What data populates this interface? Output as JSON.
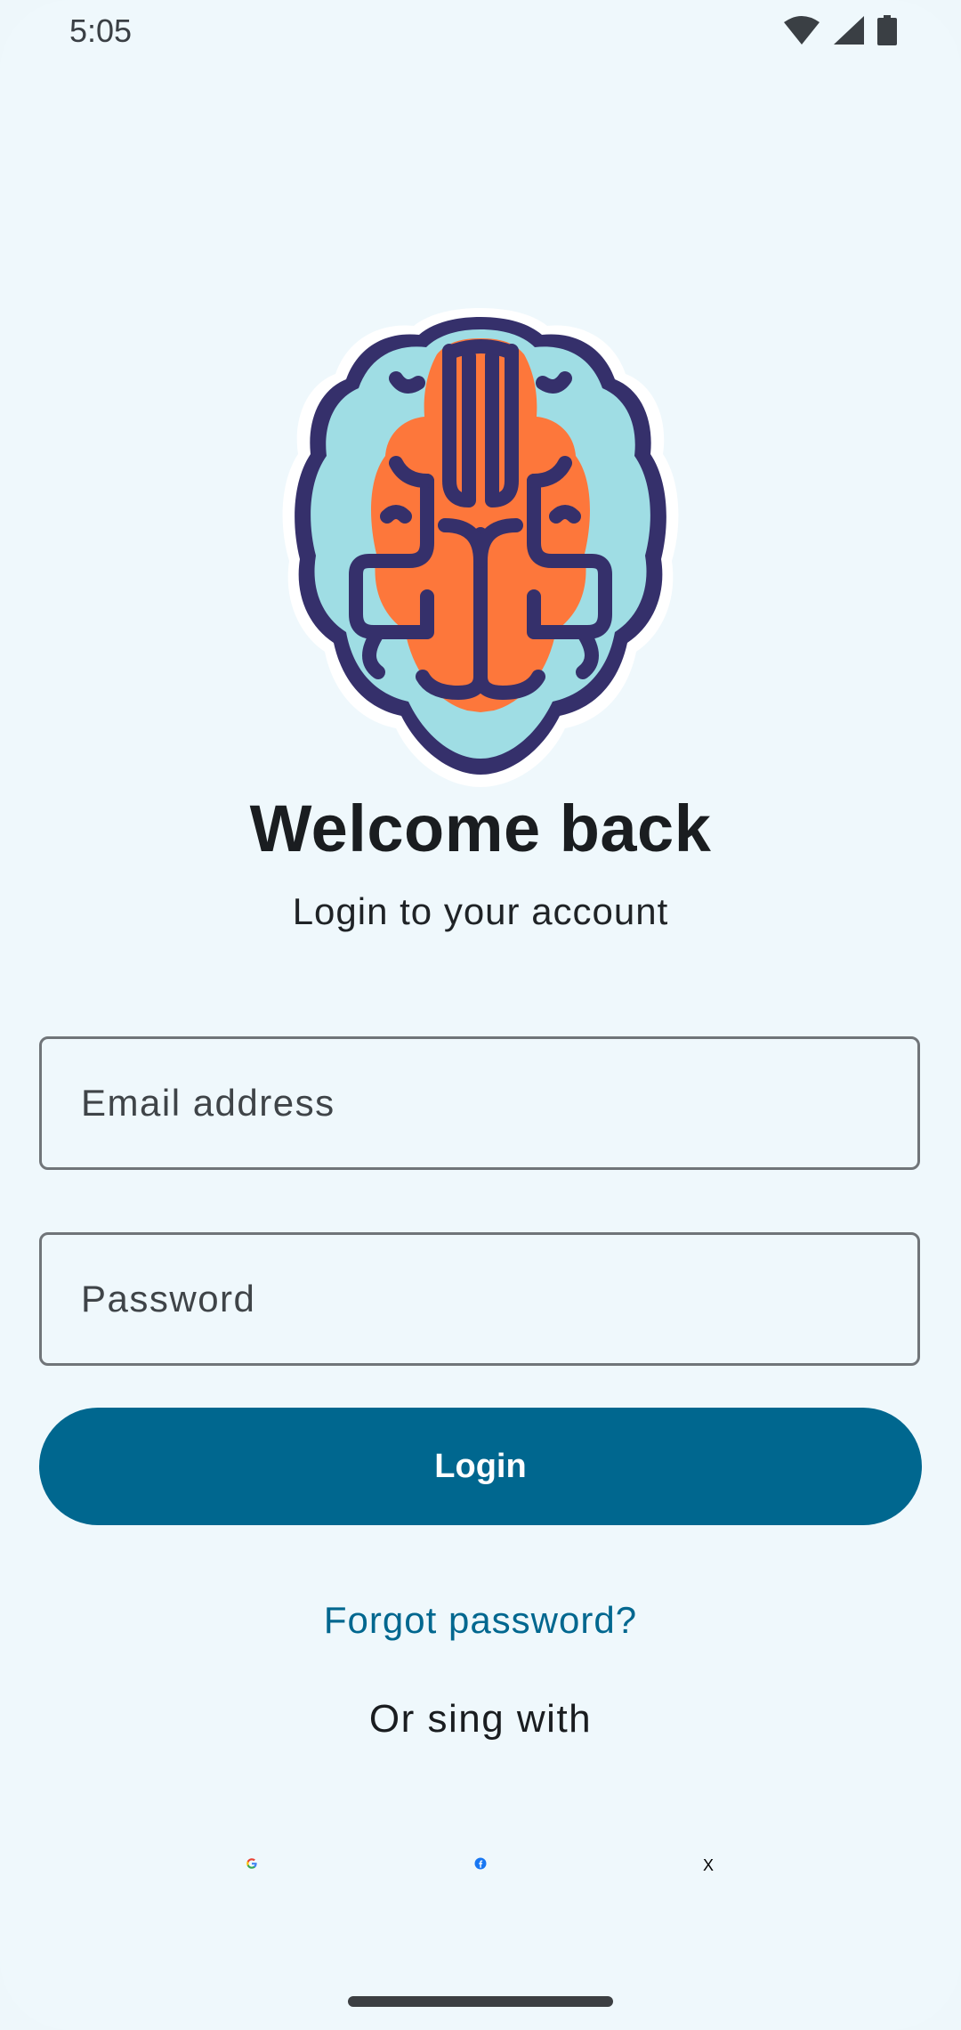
{
  "status_bar": {
    "time": "5:05",
    "icons": [
      "wifi-icon",
      "cellular-signal-icon",
      "battery-icon"
    ]
  },
  "logo": {
    "icon": "brain-logo-icon",
    "colors": {
      "outline": "#35306b",
      "outer": "#9fdde4",
      "inner": "#fd773b",
      "halo": "#ffffff"
    }
  },
  "welcome": {
    "title": "Welcome back",
    "subtitle": "Login to your account"
  },
  "form": {
    "email_placeholder": "Email address",
    "email_value": "",
    "password_placeholder": "Password",
    "password_value": "",
    "login_label": "Login"
  },
  "links": {
    "forgot_password": "Forgot password?",
    "or_sign_with": "Or sing with"
  },
  "social": {
    "google_icon": "google-icon",
    "facebook_icon": "facebook-icon",
    "x_label": "X"
  },
  "colors": {
    "background": "#eff8fc",
    "primary": "#00678f",
    "text": "#1a1d20",
    "field_border": "#707579"
  }
}
